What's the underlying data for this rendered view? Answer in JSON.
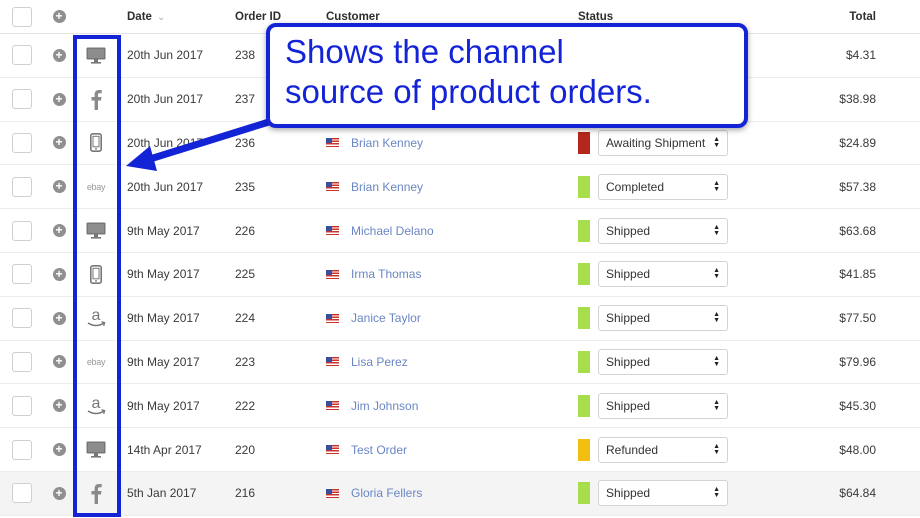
{
  "header": {
    "date_label": "Date",
    "sort_indicator": "⌄",
    "order_id_label": "Order ID",
    "customer_label": "Customer",
    "status_label": "Status",
    "total_label": "Total"
  },
  "status_colors": {
    "Awaiting Shipment": "#b4261b",
    "Completed": "#a8dd4c",
    "Shipped": "#a8dd4c",
    "Refunded": "#f2be0f"
  },
  "orders": [
    {
      "channel": "desktop-icon",
      "date": "20th Jun 2017",
      "order_id": "238",
      "customer": "",
      "status": "",
      "total": "$4.31"
    },
    {
      "channel": "facebook-icon",
      "date": "20th Jun 2017",
      "order_id": "237",
      "customer": "",
      "status": "",
      "total": "$38.98"
    },
    {
      "channel": "mobile-icon",
      "date": "20th Jun 2017",
      "order_id": "236",
      "customer": "Brian Kenney",
      "status": "Awaiting Shipment",
      "total": "$24.89"
    },
    {
      "channel": "ebay-icon",
      "date": "20th Jun 2017",
      "order_id": "235",
      "customer": "Brian Kenney",
      "status": "Completed",
      "total": "$57.38"
    },
    {
      "channel": "desktop-icon",
      "date": "9th May 2017",
      "order_id": "226",
      "customer": "Michael Delano",
      "status": "Shipped",
      "total": "$63.68"
    },
    {
      "channel": "mobile-icon",
      "date": "9th May 2017",
      "order_id": "225",
      "customer": "Irma Thomas",
      "status": "Shipped",
      "total": "$41.85"
    },
    {
      "channel": "amazon-icon",
      "date": "9th May 2017",
      "order_id": "224",
      "customer": "Janice Taylor",
      "status": "Shipped",
      "total": "$77.50"
    },
    {
      "channel": "ebay-icon",
      "date": "9th May 2017",
      "order_id": "223",
      "customer": "Lisa Perez",
      "status": "Shipped",
      "total": "$79.96"
    },
    {
      "channel": "amazon-icon",
      "date": "9th May 2017",
      "order_id": "222",
      "customer": "Jim Johnson",
      "status": "Shipped",
      "total": "$45.30"
    },
    {
      "channel": "desktop-icon",
      "date": "14th Apr 2017",
      "order_id": "220",
      "customer": "Test Order",
      "status": "Refunded",
      "total": "$48.00"
    },
    {
      "channel": "facebook-icon",
      "date": "5th Jan 2017",
      "order_id": "216",
      "customer": "Gloria Fellers",
      "status": "Shipped",
      "total": "$64.84"
    }
  ],
  "ebay_label": "ebay",
  "annotation": {
    "line1": "Shows the channel",
    "line2": "source of product orders.",
    "color": "#1323d6"
  }
}
